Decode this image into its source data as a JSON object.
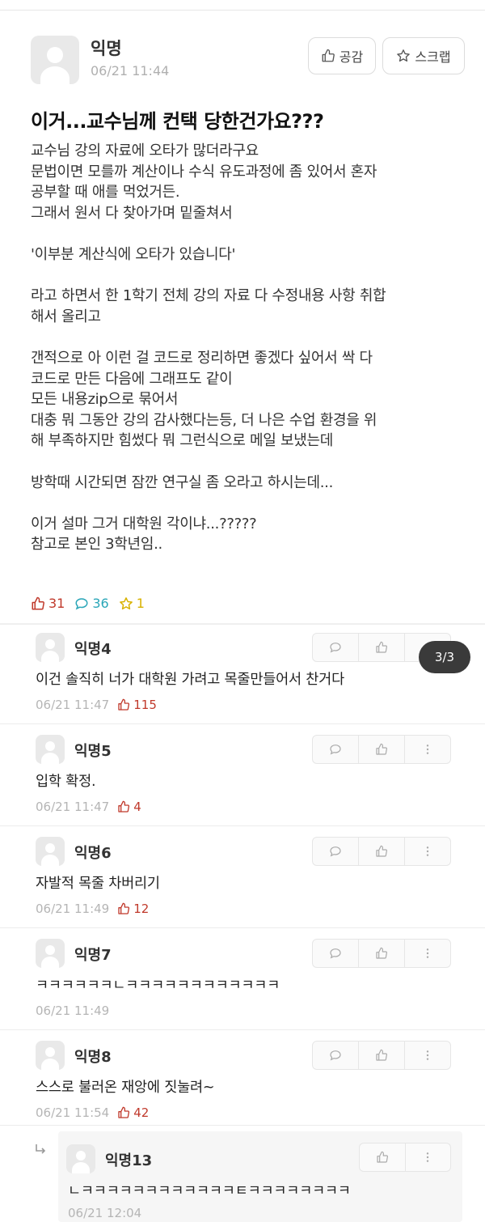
{
  "post": {
    "author": "익명",
    "time": "06/21 11:44",
    "like_button": "공감",
    "scrap_button": "스크랩",
    "title": "이거...교수님께 컨택 당한건가요???",
    "body": "교수님 강의 자료에 오타가 많더라구요\n문법이면 모를까 계산이나 수식 유도과정에 좀 있어서 혼자\n공부할 때 애를 먹었거든.\n그래서 원서 다 찾아가며 밑줄쳐서\n\n'이부분 계산식에 오타가 있습니다'\n\n라고 하면서 한 1학기 전체 강의 자료 다 수정내용 사항 취합\n해서 올리고\n\n갠적으로 아 이런 걸 코드로 정리하면 좋겠다 싶어서 싹 다\n코드로 만든 다음에 그래프도 같이\n모든 내용zip으로 묶어서\n대충 뭐 그동안 강의 감사했다는등, 더 나은 수업 환경을 위\n해 부족하지만 힘썼다 뭐 그런식으로 메일 보냈는데\n\n방학때 시간되면 잠깐 연구실 좀 오라고 하시는데...\n\n이거 설마 그거 대학원 각이냐...?????\n참고로 본인 3학년임..",
    "likes": "31",
    "comments": "36",
    "scraps": "1"
  },
  "page_indicator": "3/3",
  "comments": [
    {
      "author": "익명4",
      "text": "이건 솔직히 너가 대학원 가려고 목줄만들어서 찬거다",
      "time": "06/21 11:47",
      "likes": "115"
    },
    {
      "author": "익명5",
      "text": "입학 확정.",
      "time": "06/21 11:47",
      "likes": "4"
    },
    {
      "author": "익명6",
      "text": "자발적 목줄 차버리기",
      "time": "06/21 11:49",
      "likes": "12"
    },
    {
      "author": "익명7",
      "text": "ㅋㅋㅋㅋㅋㅋㄴㅋㅋㅋㅋㅋㅋㅋㅋㅋㅋㅋㅋ",
      "time": "06/21 11:49",
      "likes": ""
    },
    {
      "author": "익명8",
      "text": "스스로 불러온 재앙에 짓눌려~",
      "time": "06/21 11:54",
      "likes": "42"
    }
  ],
  "reply": {
    "author": "익명13",
    "text": "ㄴㅋㅋㅋㅋㅋㅋㅋㅋㅋㅋㅋㅋㅌㅋㅋㅋㅋㅋㅋㅋㅋ",
    "time": "06/21 12:04"
  },
  "colors": {
    "like": "#c0392b",
    "comment": "#2aa6b8",
    "scrap": "#d8b200"
  }
}
